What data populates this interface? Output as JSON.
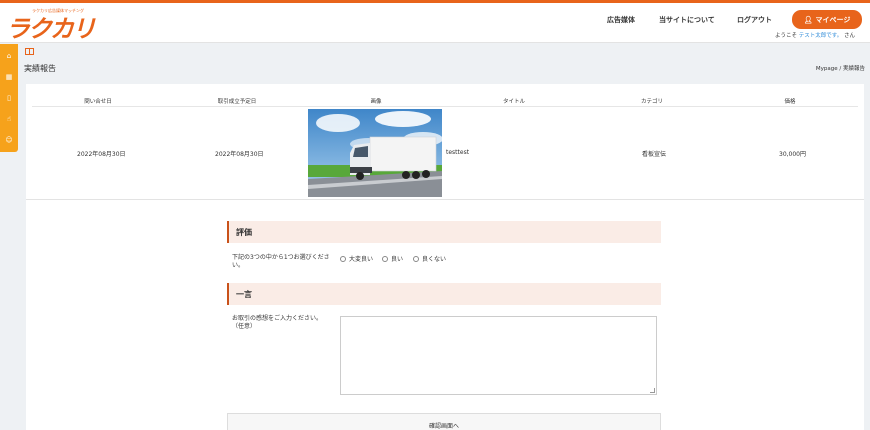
{
  "header": {
    "logo_text": "ラクカリ",
    "logo_subtitle": "ラクカリ広告媒体マッチング",
    "nav": [
      "広告媒体",
      "当サイトについて",
      "ログアウト"
    ],
    "mypage_label": "マイページ",
    "welcome_prefix": "ようこそ",
    "user_name": "テスト太郎です。",
    "welcome_suffix": "さん"
  },
  "sidebar": {
    "icons": [
      "home-icon",
      "grid-icon",
      "bookmark-icon",
      "thumbs-up-icon",
      "user-add-icon"
    ]
  },
  "page": {
    "title": "実績報告",
    "breadcrumb": "Mypage / 実績報告"
  },
  "table": {
    "headers": [
      "問い合せ日",
      "取引成立予定日",
      "画像",
      "タイトル",
      "カテゴリ",
      "価格"
    ],
    "row": {
      "inquiry_date": "2022年08月30日",
      "deal_date": "2022年08月30日",
      "title": "testtest",
      "category": "看板宣伝",
      "price": "30,000円"
    }
  },
  "evaluation": {
    "heading": "評価",
    "question": "下記の3つの中から1つお選びください。",
    "options": [
      "大変良い",
      "良い",
      "良くない"
    ]
  },
  "comment": {
    "heading": "一言",
    "label": "お取引の感想をご入力ください。（任意）",
    "value": ""
  },
  "confirm_label": "確認画面へ"
}
